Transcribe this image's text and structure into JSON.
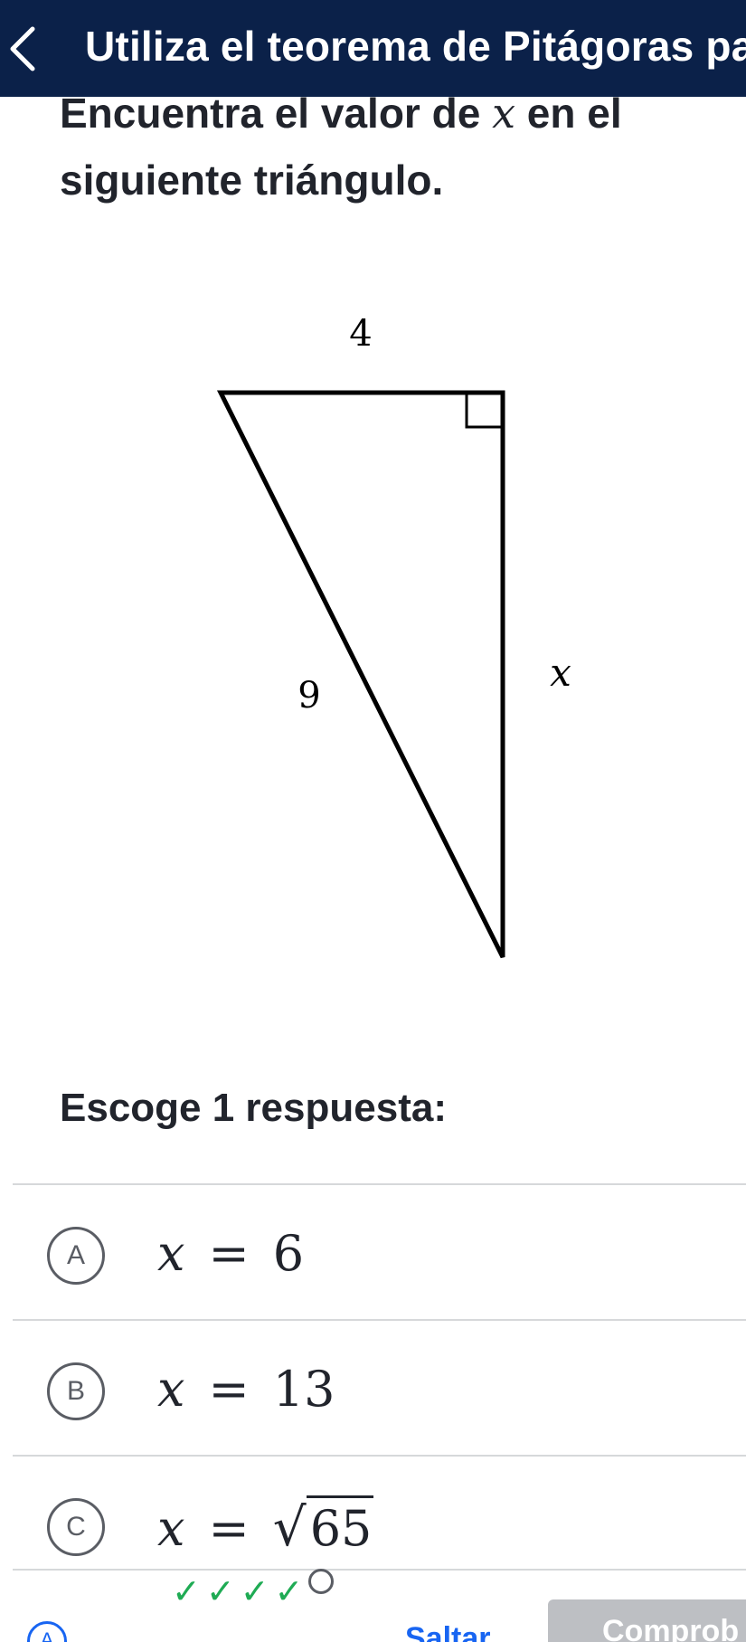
{
  "header": {
    "title": "Utiliza el teorema de Pitágoras para d"
  },
  "question": {
    "line1_prefix": "Encuentra el valor de ",
    "variable": "x",
    "line1_suffix": " en el",
    "line2": "siguiente triángulo."
  },
  "figure": {
    "top_label": "4",
    "hypotenuse_label": "9",
    "side_label": "x"
  },
  "prompt": "Escoge 1 respuesta:",
  "choices": [
    {
      "letter": "A",
      "variable": "x",
      "equals": "=",
      "value": "6"
    },
    {
      "letter": "B",
      "variable": "x",
      "equals": "=",
      "value": "13"
    },
    {
      "letter": "C",
      "variable": "x",
      "equals": "=",
      "radical": "√",
      "value": "65"
    }
  ],
  "footer": {
    "progress_marks": [
      "✓",
      "✓",
      "✓",
      "✓"
    ],
    "hint_glyph": "A",
    "skip_label": "Saltar",
    "check_label": "Comprob"
  }
}
